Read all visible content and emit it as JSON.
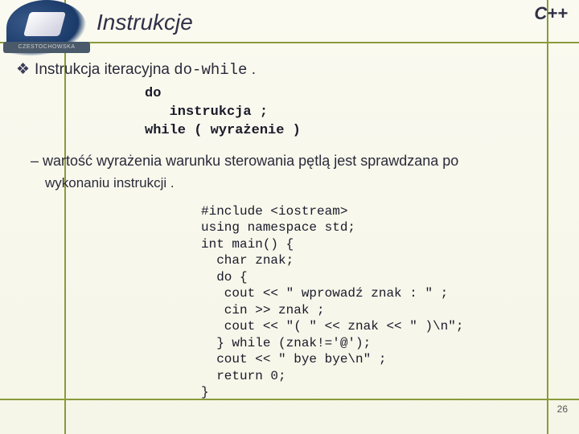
{
  "lang_tag": "C++",
  "logo_band": "CZESTOCHOWSKA",
  "title": "Instrukcje",
  "bullet_symbol": "❖",
  "bullet1_a": "Instrukcja iteracyjna ",
  "bullet1_b": "do-while",
  "bullet1_c": " .",
  "syntax": "do\n   instrukcja ;\nwhile ( wyrażenie )",
  "dash_symbol": "–",
  "dash_text": "wartość wyrażenia  warunku sterowania pętlą  jest  sprawdzana  po",
  "dash_cont": "wykonaniu instrukcji .",
  "code": "#include <iostream>\nusing namespace std;\nint main() {\n  char znak;\n  do {\n   cout << \" wprowadź znak : \" ;\n   cin >> znak ;\n   cout << \"( \" << znak << \" )\\n\";\n  } while (znak!='@');\n  cout << \" bye bye\\n\" ;\n  return 0;\n}",
  "page_number": "26"
}
